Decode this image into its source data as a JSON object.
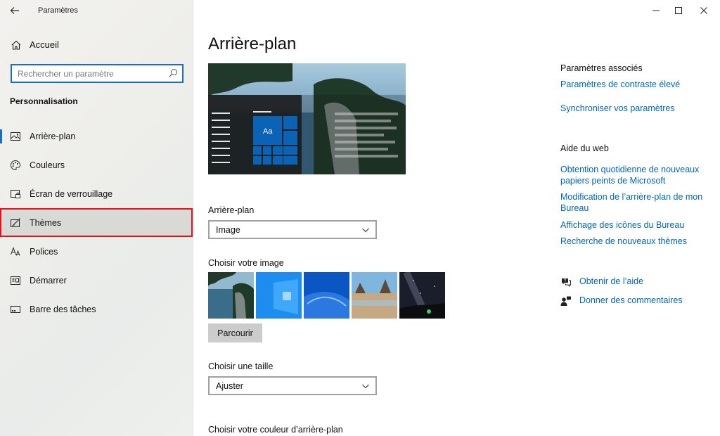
{
  "window": {
    "title": "Paramètres",
    "controls": {
      "minimize": "minimize-icon",
      "maximize": "maximize-icon",
      "close": "close-icon"
    }
  },
  "sidebar": {
    "home_label": "Accueil",
    "search_placeholder": "Rechercher un paramètre",
    "section_title": "Personnalisation",
    "items": [
      {
        "label": "Arrière-plan",
        "icon": "image-icon",
        "active": true
      },
      {
        "label": "Couleurs",
        "icon": "palette-icon"
      },
      {
        "label": "Écran de verrouillage",
        "icon": "lock-screen-icon"
      },
      {
        "label": "Thèmes",
        "icon": "brush-icon",
        "highlighted": true
      },
      {
        "label": "Polices",
        "icon": "font-icon"
      },
      {
        "label": "Démarrer",
        "icon": "start-icon"
      },
      {
        "label": "Barre des tâches",
        "icon": "taskbar-icon"
      }
    ]
  },
  "main": {
    "title": "Arrière-plan",
    "preview_tile_text": "Aa",
    "background_label": "Arrière-plan",
    "background_value": "Image",
    "choose_image_label": "Choisir votre image",
    "browse_label": "Parcourir",
    "size_label": "Choisir une taille",
    "size_value": "Ajuster",
    "color_label": "Choisir votre couleur d’arrière-plan"
  },
  "related": {
    "heading": "Paramètres associés",
    "links": [
      "Paramètres de contraste élevé",
      "Synchroniser vos paramètres"
    ]
  },
  "web_help": {
    "heading": "Aide du web",
    "links": [
      "Obtention quotidienne de nouveaux papiers peints de Microsoft",
      "Modification de l’arrière-plan de mon Bureau",
      "Affichage des icônes du Bureau",
      "Recherche de nouveaux thèmes"
    ]
  },
  "support": {
    "get_help": "Obtenir de l’aide",
    "feedback": "Donner des commentaires"
  },
  "colors": {
    "accent": "#0067b8",
    "tile_blue": "#0a63b4",
    "highlight_outline": "#e0141e"
  }
}
